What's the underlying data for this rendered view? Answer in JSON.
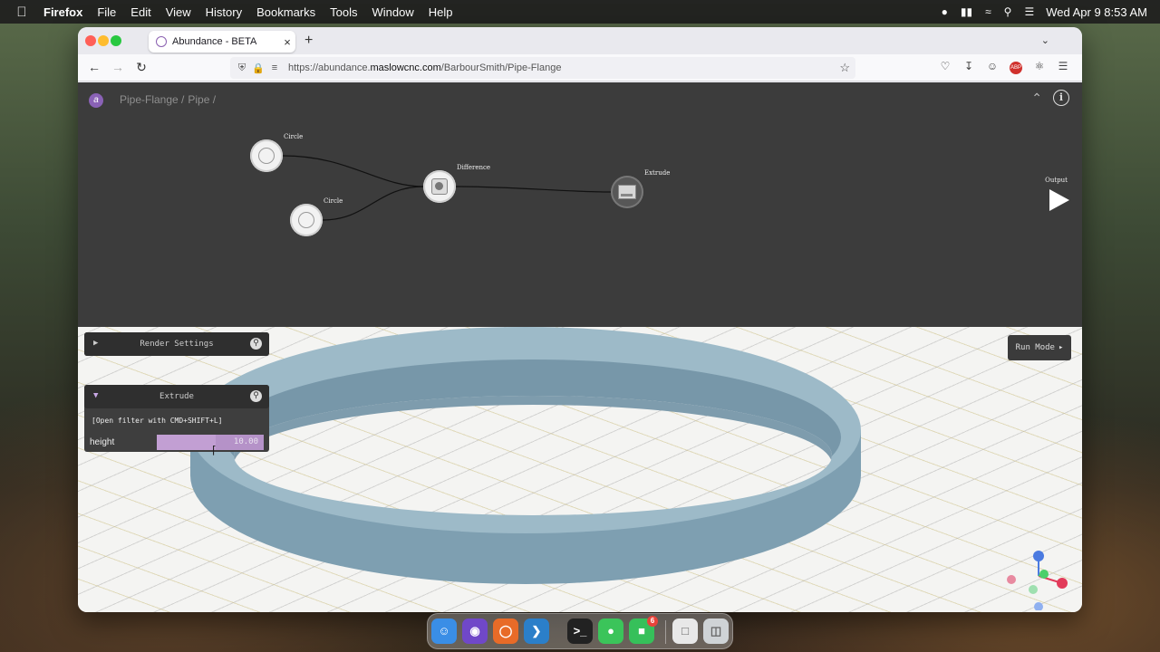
{
  "menubar": {
    "app_name": "Firefox",
    "items": [
      "File",
      "Edit",
      "View",
      "History",
      "Bookmarks",
      "Tools",
      "Window",
      "Help"
    ],
    "clock": "Wed Apr 9  8:53 AM"
  },
  "browser": {
    "tab_title": "Abundance - BETA",
    "url_prefix": "https://abundance.",
    "url_host": "maslowcnc.com",
    "url_path": "/BarbourSmith/Pipe-Flange"
  },
  "app": {
    "breadcrumbs": [
      "Pipe-Flange /",
      "Pipe /"
    ],
    "nodes": {
      "circle1": "Circle",
      "circle2": "Circle",
      "difference": "Difference",
      "extrude": "Extrude",
      "output": "Output"
    },
    "render_panel": {
      "title": "Render Settings"
    },
    "extrude_panel": {
      "title": "Extrude",
      "hint": "[Open filter with CMD+SHIFT+L]",
      "height_label": "height",
      "height_value": "10.00",
      "height_fill_fraction": 0.55
    },
    "run_mode_label": "Run Mode"
  },
  "colors": {
    "accent": "#8a62b6",
    "graph_bg": "#3c3c3c",
    "model": "#9dbac8"
  },
  "dock": {
    "messages_badge": "6"
  }
}
